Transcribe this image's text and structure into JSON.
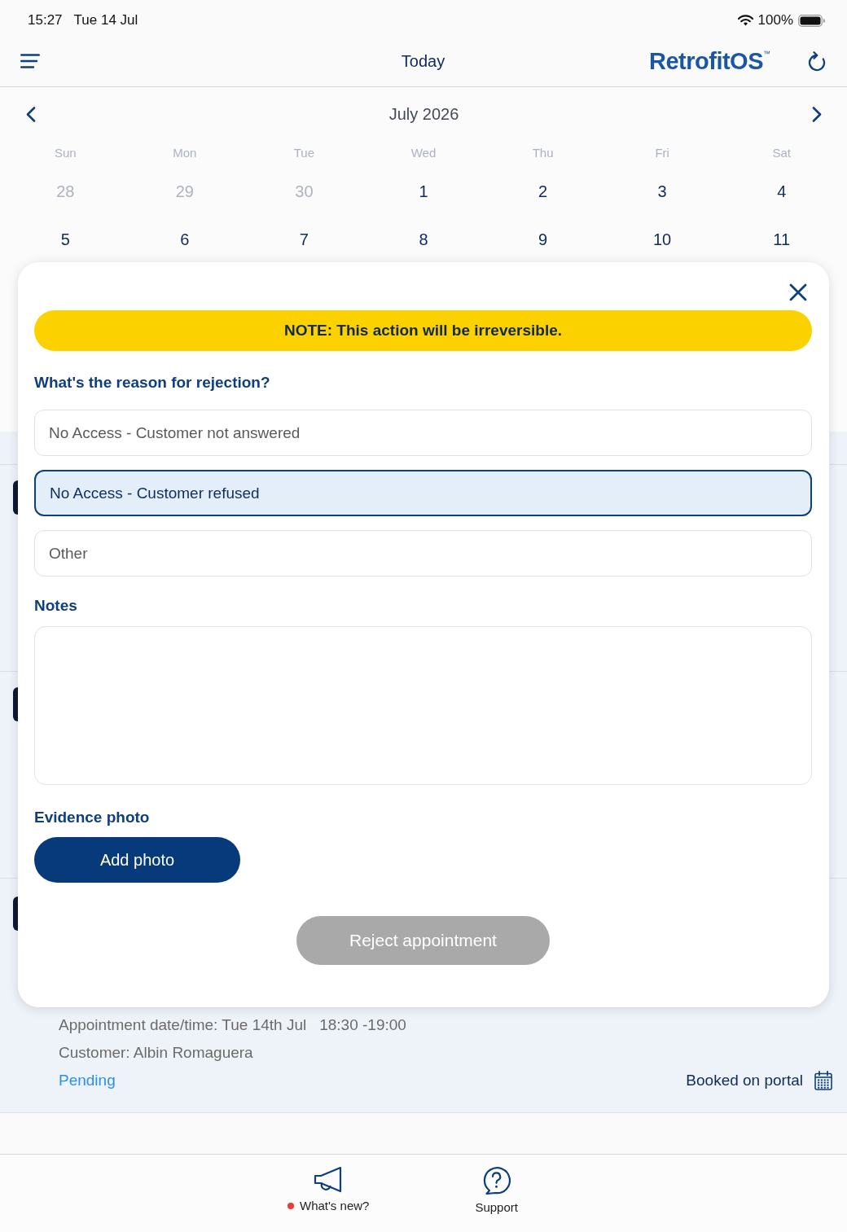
{
  "status_bar": {
    "time": "15:27",
    "date": "Tue 14 Jul",
    "battery": "100%"
  },
  "nav_bar": {
    "title": "Today",
    "logo": "RetrofitOS$^{™}$"
  },
  "calendar": {
    "month": "July 2026",
    "weekdays": [
      "Sun",
      "Mon",
      "Tue",
      "Wed",
      "Thu",
      "Fri",
      "Sat"
    ],
    "weeks": [
      [
        {
          "day": "28",
          "in_month": false
        },
        {
          "day": "29",
          "in_month": false
        },
        {
          "day": "30",
          "in_month": false
        },
        {
          "day": "1",
          "in_month": true
        },
        {
          "day": "2",
          "in_month": true
        },
        {
          "day": "3",
          "in_month": true
        },
        {
          "day": "4",
          "in_month": true
        }
      ],
      [
        {
          "day": "5",
          "in_month": true
        },
        {
          "day": "6",
          "in_month": true
        },
        {
          "day": "7",
          "in_month": true
        },
        {
          "day": "8",
          "in_month": true
        },
        {
          "day": "9",
          "in_month": true
        },
        {
          "day": "10",
          "in_month": true
        },
        {
          "day": "11",
          "in_month": true
        }
      ]
    ]
  },
  "appointments": [
    {
      "kind": "covered"
    },
    {
      "kind": "covered"
    },
    {
      "kind": "details",
      "date_time": "Appointment date/time: Tue 14th Jul",
      "time_range": "18:30 -19:00",
      "customer": "Customer: Albin Romaguera",
      "status": "Pending",
      "source": "Booked on portal"
    }
  ],
  "rejection_dialog": {
    "notice": "NOTE: This action will be irreversible.",
    "question": "What's the reason for rejection?",
    "options": [
      {
        "label": "No Access - Customer not answered",
        "selected": false
      },
      {
        "label": "No Access - Customer refused",
        "selected": true
      },
      {
        "label": "Other",
        "selected": false
      }
    ],
    "notes_label": "Notes",
    "evidence_label": "Evidence photo",
    "add_photo_button": "Add photo",
    "reject_button": {
      "label": "Reject appointment",
      "disabled": true
    }
  },
  "tab_bar": {
    "items": [
      {
        "kind": "news",
        "label": "What's new?",
        "unread": true
      },
      {
        "kind": "support",
        "label": "Support",
        "unread": false
      }
    ]
  }
}
